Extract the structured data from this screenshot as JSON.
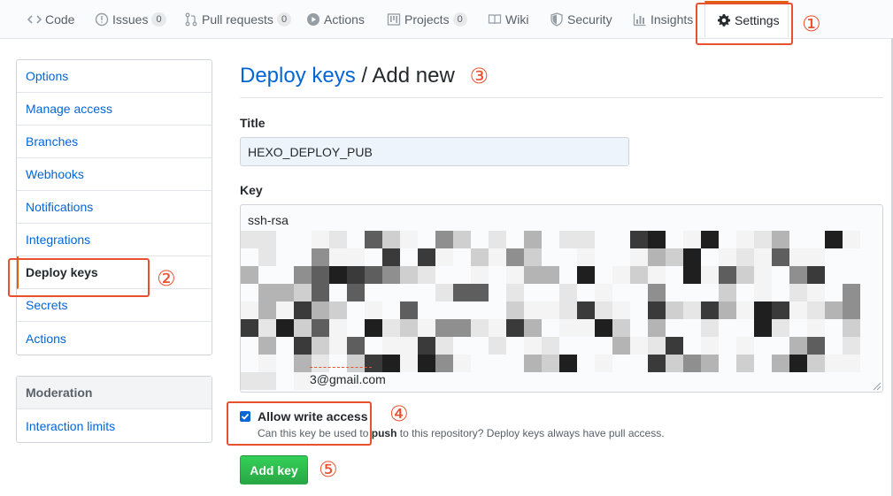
{
  "nav": {
    "tabs": [
      {
        "label": "Code",
        "icon": "code-icon"
      },
      {
        "label": "Issues",
        "count": "0",
        "icon": "issue-icon"
      },
      {
        "label": "Pull requests",
        "count": "0",
        "icon": "pull-request-icon"
      },
      {
        "label": "Actions",
        "icon": "play-icon"
      },
      {
        "label": "Projects",
        "count": "0",
        "icon": "project-icon"
      },
      {
        "label": "Wiki",
        "icon": "book-icon"
      },
      {
        "label": "Security",
        "icon": "shield-icon"
      },
      {
        "label": "Insights",
        "icon": "graph-icon"
      },
      {
        "label": "Settings",
        "icon": "gear-icon",
        "selected": true
      }
    ]
  },
  "sidebar": {
    "items": [
      "Options",
      "Manage access",
      "Branches",
      "Webhooks",
      "Notifications",
      "Integrations",
      "Deploy keys",
      "Secrets",
      "Actions"
    ],
    "selected": "Deploy keys",
    "moderation_heading": "Moderation",
    "moderation_items": [
      "Interaction limits"
    ]
  },
  "main": {
    "breadcrumb_link": "Deploy keys",
    "separator": "/",
    "title": "Add new",
    "title_label": "Title",
    "title_value": "HEXO_DEPLOY_PUB",
    "key_label": "Key",
    "key_prefix": "ssh-rsa",
    "key_suffix": "3@gmail.com",
    "write_access_label": "Allow write access",
    "write_access_checked": true,
    "write_access_note_pre": "Can this key be used to ",
    "write_access_note_bold": "push",
    "write_access_note_post": " to this repository? Deploy keys always have pull access.",
    "add_button": "Add key"
  },
  "annotations": {
    "callouts": [
      "①",
      "②",
      "③",
      "④",
      "⑤"
    ],
    "color": "#e8512f"
  },
  "colors": {
    "link": "#0366d6",
    "accent_tab": "#e36209",
    "button_green": "#28a745"
  }
}
